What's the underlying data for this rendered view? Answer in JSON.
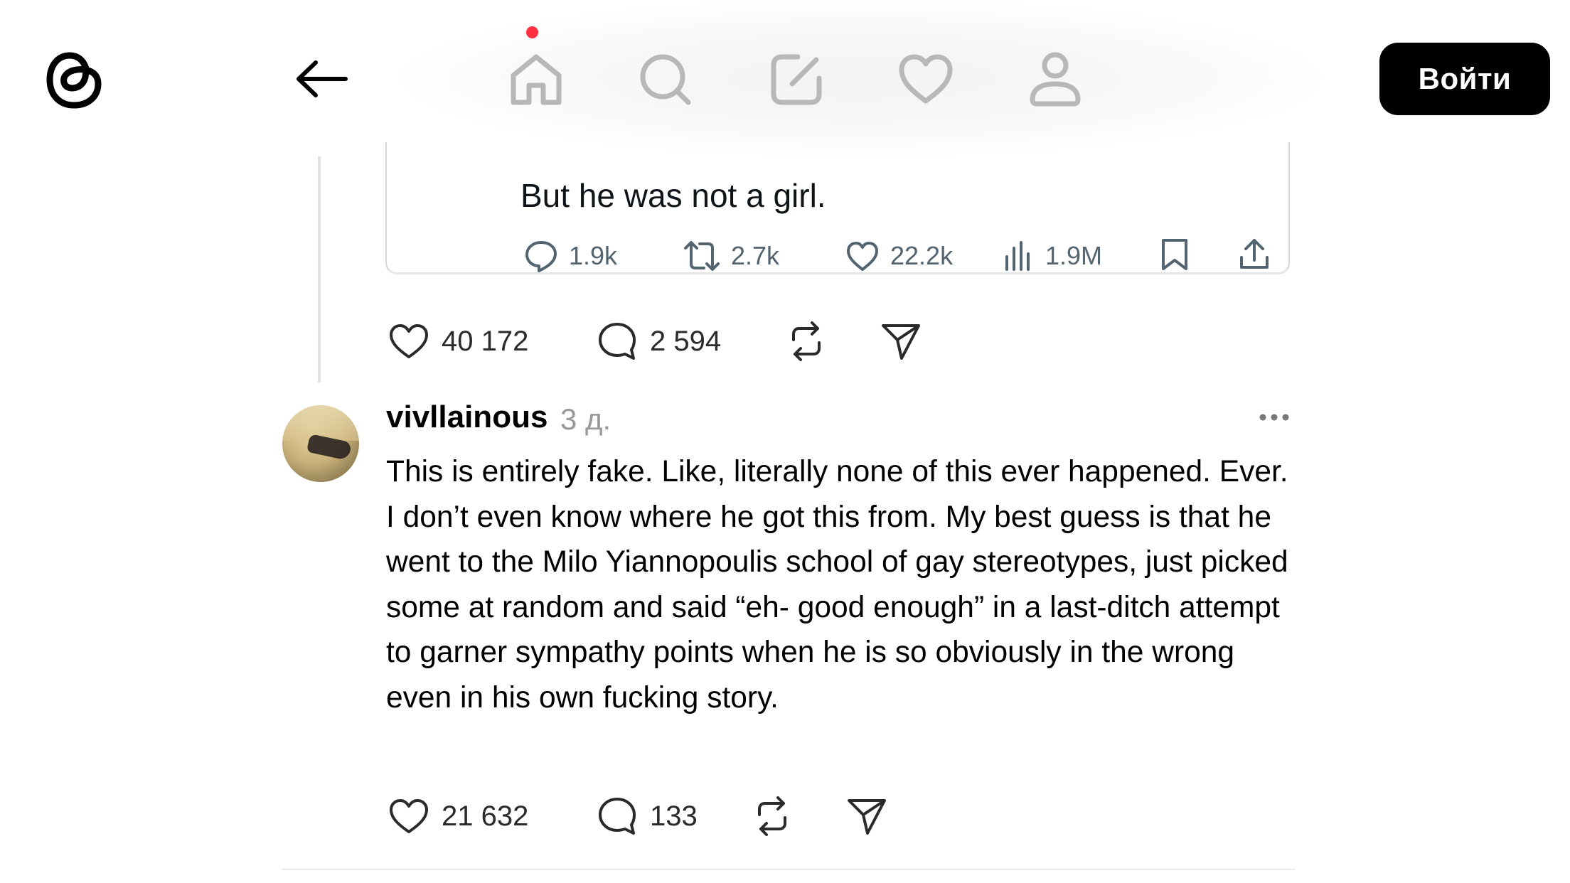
{
  "header": {
    "logo_icon": "threads-logo-icon",
    "back_icon": "back-arrow-icon",
    "nav": [
      {
        "name": "home-icon",
        "has_notification_dot": true
      },
      {
        "name": "search-icon"
      },
      {
        "name": "compose-icon"
      },
      {
        "name": "heart-icon"
      },
      {
        "name": "profile-icon"
      }
    ],
    "notification_dot_color": "#ff3040",
    "login_label": "Войти"
  },
  "embedded_tweet": {
    "text": "But he was not a girl.",
    "replies": "1.9k",
    "retweets": "2.7k",
    "likes": "22.2k",
    "views": "1.9M"
  },
  "parent_post_actions": {
    "likes": "40 172",
    "comments": "2 594"
  },
  "reply_post": {
    "username": "vivllainous",
    "time": "3 д.",
    "text": "This is entirely fake. Like, literally none of this ever happened. Ever. I don’t even know where he got this from. My best guess is that he went to the Milo Yiannopoulis school of gay stereotypes, just picked some at random and said “eh- good enough” in a last-ditch attempt to garner sympathy points when he is so obviously in the wrong even in his own fucking story.",
    "likes": "21 632",
    "comments": "133"
  }
}
